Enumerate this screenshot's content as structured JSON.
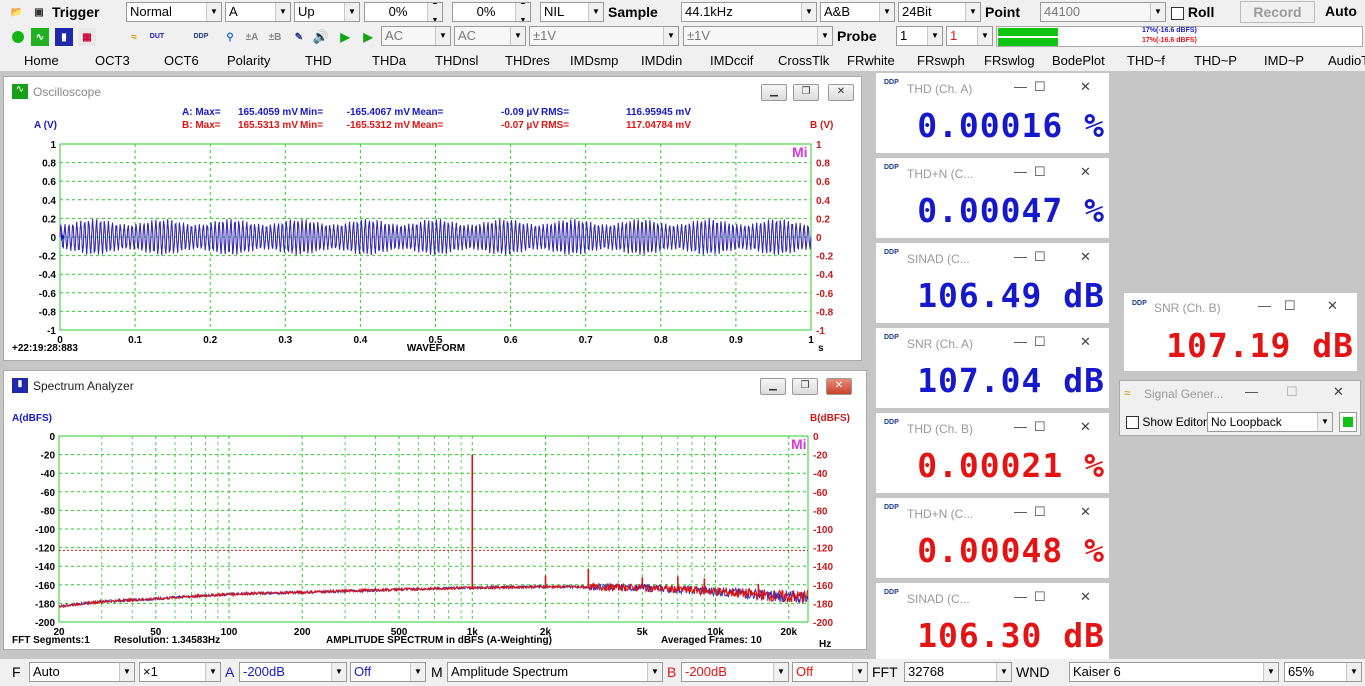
{
  "toolbar1": {
    "trigger_label": "Trigger",
    "mode": "Normal",
    "channel": "A",
    "edge": "Up",
    "level1": "0%",
    "level2": "0%",
    "nil": "NIL",
    "sample_label": "Sample",
    "sample_rate": "44.1kHz",
    "channels": "A&B",
    "bits": "24Bit",
    "point_label": "Point",
    "point_value": "44100",
    "roll_label": "Roll",
    "record_label": "Record",
    "auto_label": "Auto"
  },
  "toolbar2": {
    "coupling_a": "AC",
    "coupling_b": "AC",
    "range_a": "±1V",
    "range_b": "±1V",
    "probe_label": "Probe",
    "probe_a": "1",
    "probe_b": "1",
    "level_a_text": "17%(-16.6 dBFS)",
    "level_b_text": "17%(-16.6 dBFS)",
    "level_percent": 17,
    "icon_dut": "DUT",
    "icon_ddp": "DDP"
  },
  "menu": [
    "Home",
    "OCT3",
    "OCT6",
    "Polarity",
    "THD",
    "THDa",
    "THDnsl",
    "THDres",
    "IMDsmp",
    "IMDdin",
    "IMDccif",
    "CrossTlk",
    "FRwhite",
    "FRswph",
    "FRswlog",
    "BodePlot",
    "THD~f",
    "THD~P",
    "IMD~P",
    "AudioT"
  ],
  "oscilloscope": {
    "title": "Oscilloscope",
    "y_left_label": "A (V)",
    "y_right_label": "B (V)",
    "stats_a": {
      "label": "A: Max=",
      "max": "165.4059 mV",
      "min_label": "Min=",
      "min": "-165.4067 mV",
      "mean_label": "Mean=",
      "mean": "-0.09  µV",
      "rms_label": "RMS=",
      "rms": "116.95945 mV"
    },
    "stats_b": {
      "label": "B: Max=",
      "max": "165.5313 mV",
      "min_label": "Min=",
      "min": "-165.5312 mV",
      "mean_label": "Mean=",
      "mean": "-0.07  µV",
      "rms_label": "RMS=",
      "rms": "117.04784 mV"
    },
    "timestamp": "+22:19:28:883",
    "xlabel": "WAVEFORM",
    "xunit": "s",
    "logo": "Mi"
  },
  "spectrum": {
    "title": "Spectrum Analyzer",
    "y_left_label": "A(dBFS)",
    "y_right_label": "B(dBFS)",
    "fft_segments": "FFT Segments:1",
    "resolution": "Resolution: 1.34583Hz",
    "xlabel": "AMPLITUDE  SPECTRUM in dBFS (A-Weighting)",
    "averaged": "Averaged Frames: 10",
    "xunit": "Hz",
    "logo": "Mi"
  },
  "chart_data": [
    {
      "type": "line",
      "title": "",
      "xlabel": "WAVEFORM",
      "ylabel": "A (V)",
      "y2label": "B (V)",
      "xlim": [
        0,
        1
      ],
      "ylim": [
        -1,
        1
      ],
      "x_ticks": [
        "0",
        "0.1",
        "0.2",
        "0.3",
        "0.4",
        "0.5",
        "0.6",
        "0.7",
        "0.8",
        "0.9",
        "1"
      ],
      "y_ticks": [
        "1",
        "0.8",
        "0.6",
        "0.4",
        "0.2",
        "0",
        "-0.2",
        "-0.4",
        "-0.6",
        "-0.8",
        "-1"
      ],
      "grid": true,
      "series": [
        {
          "name": "A",
          "amplitude": 0.1654,
          "color": "#1f2bc9"
        },
        {
          "name": "B",
          "amplitude": 0.1655,
          "color": "#b01818"
        }
      ]
    },
    {
      "type": "line",
      "title": "",
      "xlabel": "AMPLITUDE  SPECTRUM in dBFS (A-Weighting)",
      "ylabel": "A(dBFS)",
      "y2label": "B(dBFS)",
      "x_scale": "log",
      "xlim": [
        20,
        24000
      ],
      "ylim": [
        -200,
        0
      ],
      "x_ticks": [
        "20",
        "50",
        "100",
        "200",
        "500",
        "1k",
        "2k",
        "5k",
        "10k",
        "20k"
      ],
      "y_ticks": [
        "0",
        "-20",
        "-40",
        "-60",
        "-80",
        "-100",
        "-120",
        "-140",
        "-160",
        "-180",
        "-200"
      ],
      "grid": true,
      "reference_line_db": -123,
      "series": [
        {
          "name": "A",
          "color": "#1f2bc9",
          "x": [
            20,
            30,
            50,
            100,
            200,
            500,
            1000,
            2000,
            5000,
            10000,
            20000
          ],
          "y": [
            -183,
            -178,
            -175,
            -170,
            -168,
            -165,
            -163,
            -162,
            -163,
            -167,
            -173
          ]
        },
        {
          "name": "B",
          "color": "#d81414",
          "x": [
            20,
            30,
            50,
            100,
            200,
            500,
            1000,
            2000,
            5000,
            10000,
            20000
          ],
          "y": [
            -183,
            -178,
            -175,
            -170,
            -168,
            -165,
            -163,
            -162,
            -163,
            -167,
            -173
          ]
        }
      ],
      "peaks": [
        {
          "x": 1000,
          "y": -20
        },
        {
          "x": 2000,
          "y": -150
        },
        {
          "x": 3000,
          "y": -143
        },
        {
          "x": 5000,
          "y": -152
        },
        {
          "x": 7000,
          "y": -151
        },
        {
          "x": 9000,
          "y": -153
        },
        {
          "x": 15000,
          "y": -159
        }
      ]
    }
  ],
  "meters": [
    {
      "title": "THD (Ch. A)",
      "value": "0.00016 %",
      "color": "#1619c9"
    },
    {
      "title": "THD+N (C...",
      "value": "0.00047 %",
      "color": "#1619c9"
    },
    {
      "title": "SINAD (C...",
      "value": "106.49 dB",
      "color": "#1619c9"
    },
    {
      "title": "SNR (Ch. A)",
      "value": "107.04 dB",
      "color": "#1619c9"
    },
    {
      "title": "THD (Ch. B)",
      "value": "0.00021 %",
      "color": "#e41414"
    },
    {
      "title": "THD+N (C...",
      "value": "0.00048 %",
      "color": "#e41414"
    },
    {
      "title": "SINAD (C...",
      "value": "106.30 dB",
      "color": "#e41414"
    }
  ],
  "snr_b": {
    "title": "SNR (Ch. B)",
    "value": "107.19 dB"
  },
  "signal_generator": {
    "title": "Signal Gener...",
    "show_editor": "Show Editor",
    "loopback": "No Loopback"
  },
  "bottom": {
    "f_label": "F",
    "f_value": "Auto",
    "mult": "×1",
    "a_label": "A",
    "a_db": "-200dB",
    "a_off": "Off",
    "m_label": "M",
    "mode": "Amplitude Spectrum",
    "b_label": "B",
    "b_db": "-200dB",
    "b_off": "Off",
    "fft_label": "FFT",
    "fft_size": "32768",
    "wnd_label": "WND",
    "window": "Kaiser 6",
    "zoom": "65%"
  }
}
